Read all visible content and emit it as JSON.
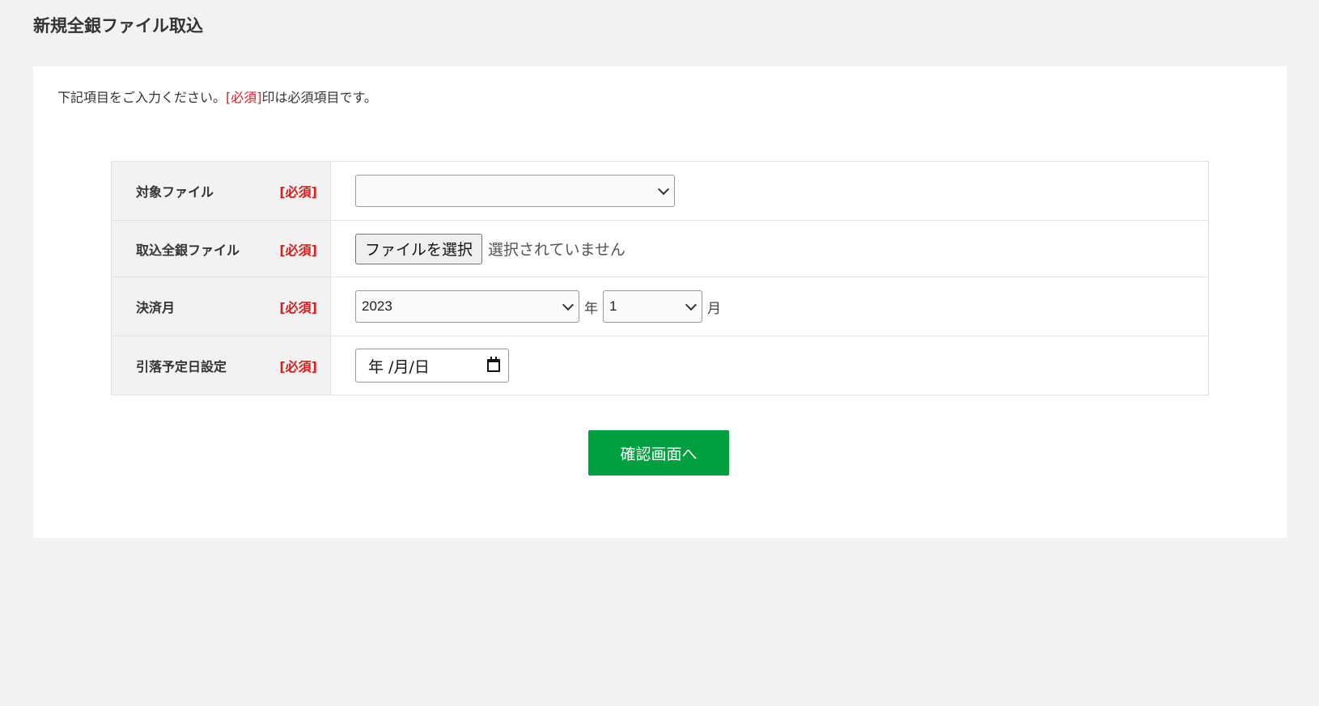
{
  "page": {
    "title": "新規全銀ファイル取込"
  },
  "intro": {
    "before": "下記項目をご入力ください。",
    "required_mark": "[必須]",
    "after": "印は必須項目です。"
  },
  "form": {
    "required_label": "[必須]",
    "rows": [
      {
        "label": "対象ファイル"
      },
      {
        "label": "取込全銀ファイル"
      },
      {
        "label": "決済月"
      },
      {
        "label": "引落予定日設定"
      }
    ],
    "target_file": {
      "selected": ""
    },
    "file_input": {
      "button_label": "ファイルを選択",
      "status": "選択されていません"
    },
    "settlement_month": {
      "year_value": "2023",
      "year_unit": "年",
      "month_value": "1",
      "month_unit": "月"
    },
    "withdrawal_date": {
      "placeholder": "年 /月/日"
    }
  },
  "actions": {
    "confirm_label": "確認画面へ"
  },
  "colors": {
    "page_bg": "#f2f2f2",
    "panel_bg": "#ffffff",
    "required": "#d71f1f",
    "primary_button": "#00a040"
  }
}
